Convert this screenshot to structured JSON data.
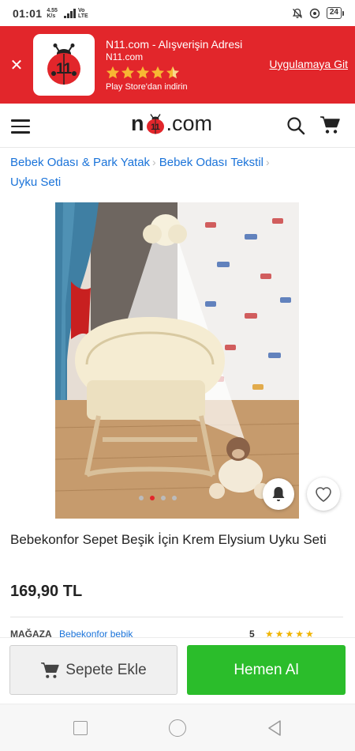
{
  "status_bar": {
    "time": "01:01",
    "network_speed": "4.55",
    "network_unit": "K/s",
    "volte": "Vo",
    "lte": "LTE",
    "battery": "24"
  },
  "app_banner": {
    "title": "N11.com - Alışverişin Adresi",
    "domain": "N11.com",
    "rating": 4.5,
    "store_text": "Play Store'dan indirin",
    "action": "Uygulamaya Git",
    "close_icon": "close-icon",
    "background": "#e2262b"
  },
  "header": {
    "logo_n": "n",
    "logo_eleven": "11",
    "logo_suffix": ".com"
  },
  "breadcrumb": {
    "items": [
      "Bebek Odası & Park Yatak",
      "Bebek Odası Tekstil",
      "Uyku Seti"
    ]
  },
  "gallery": {
    "image_count": 4,
    "active_index": 1
  },
  "product": {
    "title": "Bebekonfor Sepet Beşik İçin Krem Elysium Uyku Seti",
    "price": "169,90 TL"
  },
  "seller": {
    "label": "MAĞAZA",
    "name": "Bebekonfor bebik",
    "rating_label": "5"
  },
  "actions": {
    "add_to_cart": "Sepete Ekle",
    "buy_now": "Hemen Al",
    "buy_color": "#2bbd2b"
  }
}
